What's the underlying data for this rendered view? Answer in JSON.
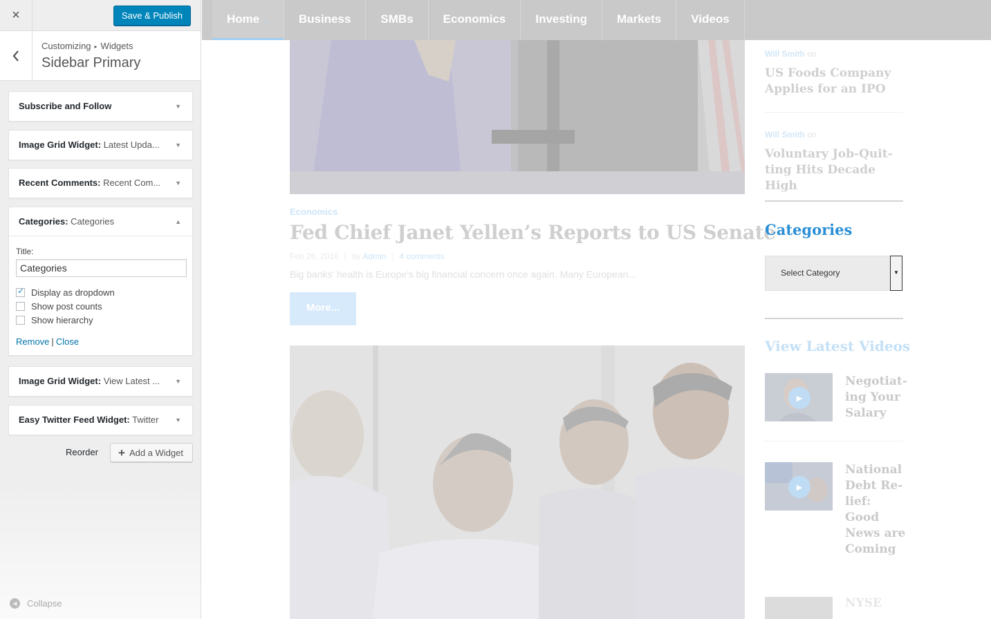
{
  "customizer": {
    "close_label": "×",
    "save_label": "Save & Publish",
    "breadcrumb": {
      "root": "Customizing",
      "separator": "▸",
      "current": "Widgets"
    },
    "section_title": "Sidebar Primary",
    "widgets": [
      {
        "name": "Subscribe and Follow",
        "sub": "",
        "expanded": false
      },
      {
        "name": "Image Grid Widget",
        "sub": "Latest Upda...",
        "expanded": false
      },
      {
        "name": "Recent Comments",
        "sub": "Recent Com...",
        "expanded": false
      },
      {
        "name": "Categories",
        "sub": "Categories",
        "expanded": true
      },
      {
        "name": "Image Grid Widget",
        "sub": "View Latest ...",
        "expanded": false
      },
      {
        "name": "Easy Twitter Feed Widget",
        "sub": "Twitter",
        "expanded": false
      }
    ],
    "categories_form": {
      "title_label": "Title:",
      "title_value": "Categories",
      "options": [
        {
          "label": "Display as dropdown",
          "checked": true
        },
        {
          "label": "Show post counts",
          "checked": false
        },
        {
          "label": "Show hierarchy",
          "checked": false
        }
      ],
      "remove_label": "Remove",
      "pipe": "|",
      "close_label": "Close"
    },
    "reorder_label": "Reorder",
    "add_widget_label": "Add a Widget",
    "collapse_label": "Collapse"
  },
  "preview": {
    "nav": [
      "Home",
      "Business",
      "SMBs",
      "Economics",
      "Investing",
      "Markets",
      "Videos"
    ],
    "post": {
      "category": "Economics",
      "title": "Fed Chief Janet Yellen’s Reports to US Senate",
      "date": "Feb 26, 2016",
      "by": "by",
      "author": "Admin",
      "comments": "4 comments",
      "excerpt": "Big banks' health is Europe's big financial concern once again. Many European...",
      "more_label": "More..."
    },
    "sidebar": {
      "recent": [
        {
          "author": "Will Smith",
          "on": "on",
          "title": "US Foods Company Applies for an IPO"
        },
        {
          "author": "Will Smith",
          "on": "on",
          "title": "Voluntary Job-Quit-ting Hits Decade High"
        }
      ],
      "categories_heading": "Categories",
      "select_placeholder": "Select Category",
      "videos_heading": "View Latest Videos",
      "videos": [
        {
          "title": "Negotiat-ing Your Salary"
        },
        {
          "title": "National Debt Re-lief: Good News are Coming"
        },
        {
          "title": "NYSE"
        }
      ]
    }
  },
  "colors": {
    "accent": "#0085ba",
    "link": "#0073aa",
    "categories_heading": "#2a8fd6"
  }
}
